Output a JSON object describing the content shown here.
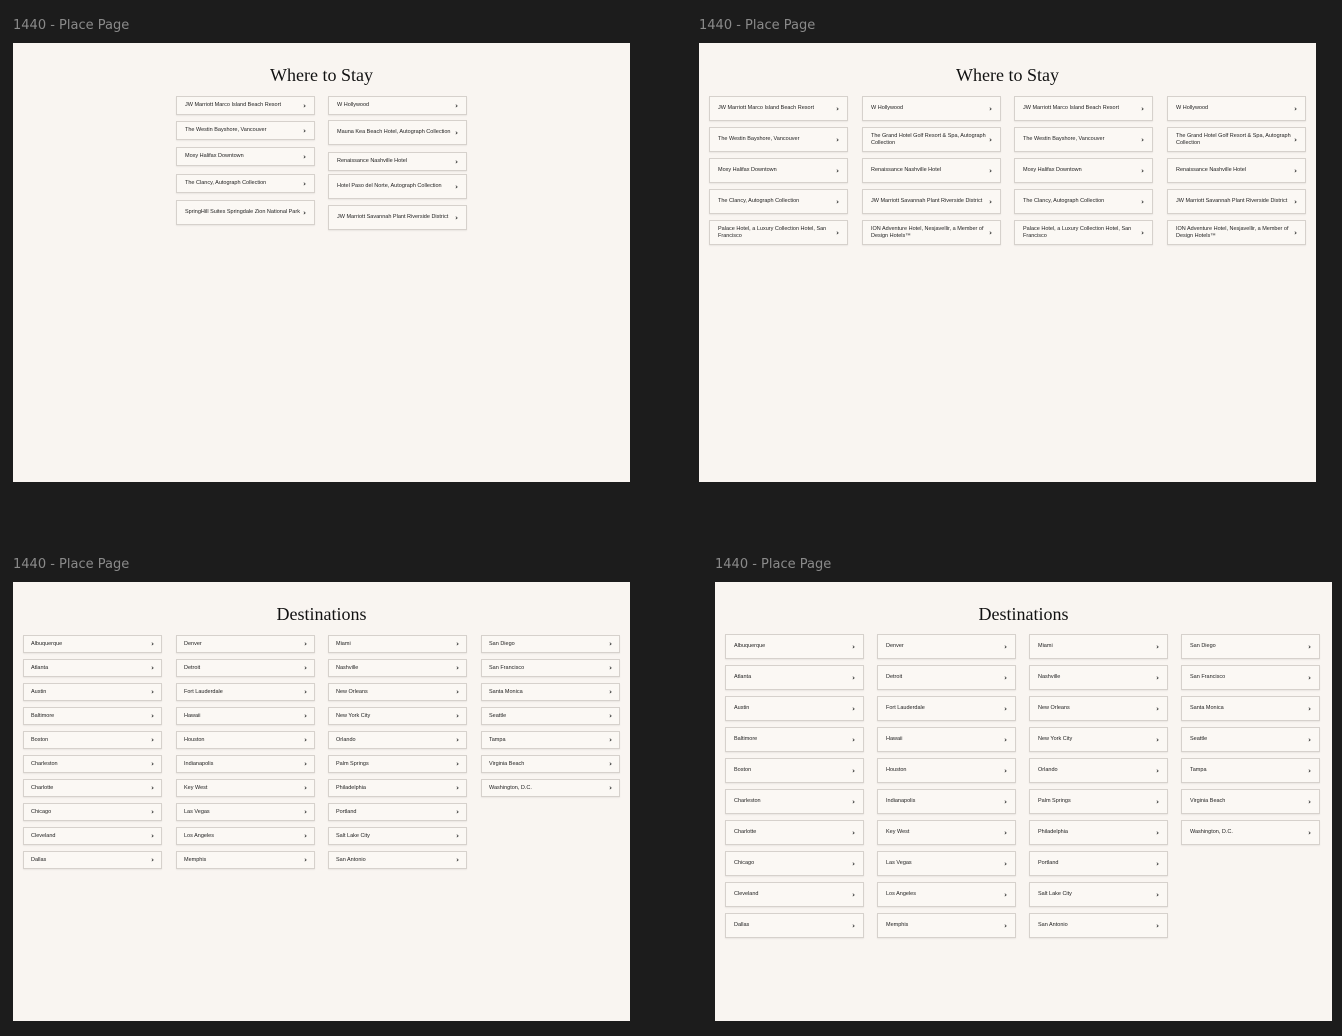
{
  "frames": [
    {
      "label": "1440 - Place Page",
      "heading": "Where to Stay",
      "columns": [
        [
          "JW Marriott Marco Island Beach Resort",
          "The Westin Bayshore, Vancouver",
          "Moxy Halifax Downtown",
          "The Clancy, Autograph Collection",
          "SpringHill Suites Springdale Zion National Park"
        ],
        [
          "W Hollywood",
          "Mauna Kea Beach Hotel, Autograph Collection",
          "Renaissance Nashville Hotel",
          "Hotel Paso del Norte, Autograph Collection",
          "JW Marriott Savannah Plant Riverside District"
        ]
      ]
    },
    {
      "label": "1440 - Place Page",
      "heading": "Where to Stay",
      "columns": [
        [
          "JW Marriott Marco Island Beach Resort",
          "The Westin Bayshore, Vancouver",
          "Moxy Halifax Downtown",
          "The Clancy, Autograph Collection",
          "Palace Hotel, a Luxury Collection Hotel, San Francisco"
        ],
        [
          "W Hollywood",
          "The Grand Hotel Golf Resort & Spa, Autograph Collection",
          "Renaissance Nashville Hotel",
          "JW Marriott Savannah Plant Riverside District",
          "ION Adventure Hotel, Nesjavellir, a Member of Design Hotels™"
        ],
        [
          "JW Marriott Marco Island Beach Resort",
          "The Westin Bayshore, Vancouver",
          "Moxy Halifax Downtown",
          "The Clancy, Autograph Collection",
          "Palace Hotel, a Luxury Collection Hotel, San Francisco"
        ],
        [
          "W Hollywood",
          "The Grand Hotel Golf Resort & Spa, Autograph Collection",
          "Renaissance Nashville Hotel",
          "JW Marriott Savannah Plant Riverside District",
          "ION Adventure Hotel, Nesjavellir, a Member of Design Hotels™"
        ]
      ]
    },
    {
      "label": "1440 - Place Page",
      "heading": "Destinations",
      "columns": [
        [
          "Albuquerque",
          "Atlanta",
          "Austin",
          "Baltimore",
          "Boston",
          "Charleston",
          "Charlotte",
          "Chicago",
          "Cleveland",
          "Dallas"
        ],
        [
          "Denver",
          "Detroit",
          "Fort Lauderdale",
          "Hawaii",
          "Houston",
          "Indianapolis",
          "Key West",
          "Las Vegas",
          "Los Angeles",
          "Memphis"
        ],
        [
          "Miami",
          "Nashville",
          "New Orleans",
          "New York City",
          "Orlando",
          "Palm Springs",
          "Philadelphia",
          "Portland",
          "Salt Lake City",
          "San Antonio"
        ],
        [
          "San Diego",
          "San Francisco",
          "Santa Monica",
          "Seattle",
          "Tampa",
          "Virginia Beach",
          "Washington, D.C."
        ]
      ]
    },
    {
      "label": "1440 - Place Page",
      "heading": "Destinations",
      "columns": [
        [
          "Albuquerque",
          "Atlanta",
          "Austin",
          "Baltimore",
          "Boston",
          "Charleston",
          "Charlotte",
          "Chicago",
          "Cleveland",
          "Dallas"
        ],
        [
          "Denver",
          "Detroit",
          "Fort Lauderdale",
          "Hawaii",
          "Houston",
          "Indianapolis",
          "Key West",
          "Las Vegas",
          "Los Angeles",
          "Memphis"
        ],
        [
          "Miami",
          "Nashville",
          "New Orleans",
          "New York City",
          "Orlando",
          "Palm Springs",
          "Philadelphia",
          "Portland",
          "Salt Lake City",
          "San Antonio"
        ],
        [
          "San Diego",
          "San Francisco",
          "Santa Monica",
          "Seattle",
          "Tampa",
          "Virginia Beach",
          "Washington, D.C."
        ]
      ]
    }
  ],
  "chevron": "›",
  "colors": {
    "canvas": "#1c1c1c",
    "frame_bg": "#f9f5f1",
    "card_border": "#d6d1cc",
    "frame_title": "#8a8a8a"
  }
}
